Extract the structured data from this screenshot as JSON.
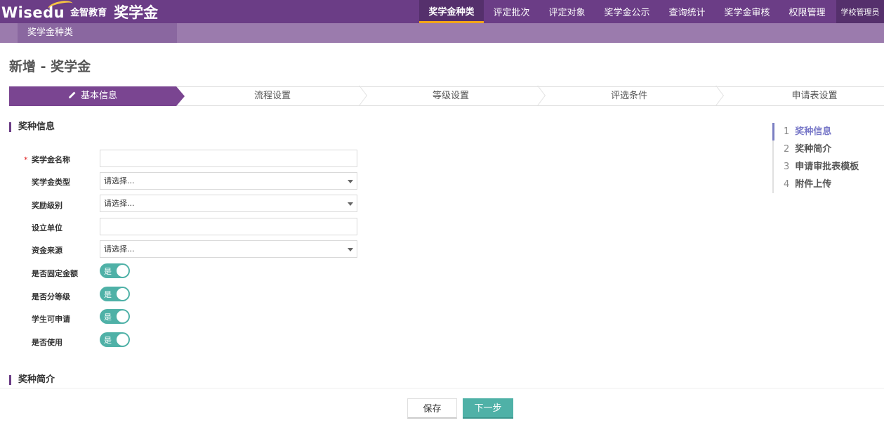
{
  "app": {
    "brand": "Wisedu",
    "brand_cn": "金智教育",
    "title": "奖学金"
  },
  "nav": {
    "items": [
      {
        "label": "奖学金种类",
        "active": true
      },
      {
        "label": "评定批次"
      },
      {
        "label": "评定对象"
      },
      {
        "label": "奖学金公示"
      },
      {
        "label": "查询统计"
      },
      {
        "label": "奖学金审核"
      },
      {
        "label": "权限管理"
      }
    ],
    "user": "学校管理员"
  },
  "subnav": {
    "tab": "奖学金种类"
  },
  "page": {
    "title": "新增 - 奖学金"
  },
  "steps": [
    {
      "label": "基本信息",
      "active": true
    },
    {
      "label": "流程设置"
    },
    {
      "label": "等级设置"
    },
    {
      "label": "评选条件"
    },
    {
      "label": "申请表设置"
    }
  ],
  "sections": {
    "basic": "奖种信息",
    "intro": "奖种简介"
  },
  "form": {
    "required_mark": "*",
    "name": {
      "label": "奖学金名称",
      "value": ""
    },
    "type": {
      "label": "奖学金类型",
      "value": "请选择..."
    },
    "level": {
      "label": "奖励级别",
      "value": "请选择..."
    },
    "unit": {
      "label": "设立单位",
      "value": ""
    },
    "fund": {
      "label": "资金来源",
      "value": "请选择..."
    },
    "fixed_amount": {
      "label": "是否固定金额",
      "toggle": "是"
    },
    "graded": {
      "label": "是否分等级",
      "toggle": "是"
    },
    "student_apply": {
      "label": "学生可申请",
      "toggle": "是"
    },
    "in_use": {
      "label": "是否使用",
      "toggle": "是"
    }
  },
  "outline": [
    {
      "num": "1",
      "label": "奖种信息",
      "active": true
    },
    {
      "num": "2",
      "label": "奖种简介"
    },
    {
      "num": "3",
      "label": "申请审批表模板"
    },
    {
      "num": "4",
      "label": "附件上传"
    }
  ],
  "buttons": {
    "save": "保存",
    "next": "下一步"
  },
  "colors": {
    "header": "#6b3d86",
    "subbar": "#9b7bad",
    "accent": "#4fb1a7",
    "nav_active_underline": "#f2a51a",
    "outline_active": "#7b7fc2"
  }
}
